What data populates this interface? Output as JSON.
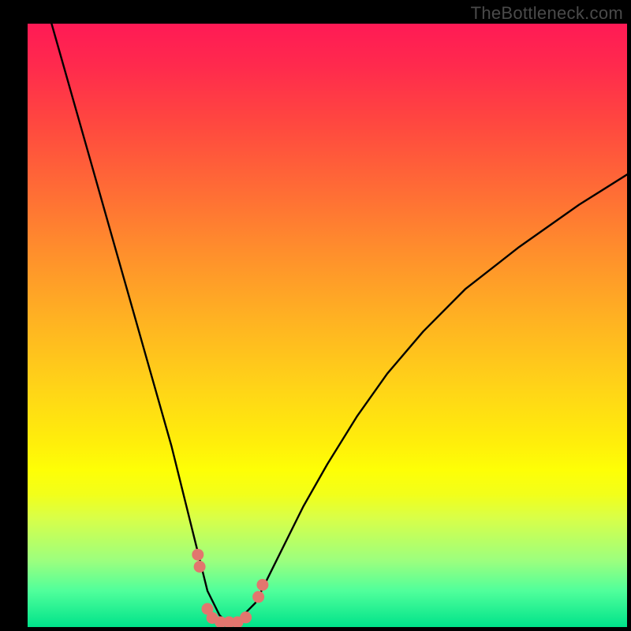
{
  "watermark": "TheBottleneck.com",
  "chart_data": {
    "type": "line",
    "title": "",
    "xlabel": "",
    "ylabel": "",
    "xlim": [
      0,
      100
    ],
    "ylim": [
      0,
      100
    ],
    "series": [
      {
        "name": "bottleneck-curve",
        "x": [
          4,
          6,
          8,
          10,
          12,
          14,
          16,
          18,
          20,
          22,
          24,
          26,
          28,
          29,
          30,
          31,
          32,
          33,
          34,
          35,
          36,
          38,
          40,
          43,
          46,
          50,
          55,
          60,
          66,
          73,
          82,
          92,
          100
        ],
        "values": [
          100,
          93,
          86,
          79,
          72,
          65,
          58,
          51,
          44,
          37,
          30,
          22,
          14,
          10,
          6,
          4,
          2,
          1,
          1,
          1,
          2,
          4,
          8,
          14,
          20,
          27,
          35,
          42,
          49,
          56,
          63,
          70,
          75
        ]
      }
    ],
    "markers": {
      "name": "highlight-dots",
      "color": "#e2766e",
      "points": [
        {
          "x": 28.4,
          "y": 12
        },
        {
          "x": 28.7,
          "y": 10
        },
        {
          "x": 30.0,
          "y": 3
        },
        {
          "x": 30.8,
          "y": 1.5
        },
        {
          "x": 32.2,
          "y": 0.8
        },
        {
          "x": 33.6,
          "y": 0.8
        },
        {
          "x": 35.0,
          "y": 0.8
        },
        {
          "x": 36.4,
          "y": 1.6
        },
        {
          "x": 38.5,
          "y": 5
        },
        {
          "x": 39.2,
          "y": 7
        }
      ]
    },
    "background_gradient": {
      "top_color": "#ff1a55",
      "bottom_color": "#00e38a",
      "description": "vertical spectrum red-orange-yellow-green"
    }
  }
}
